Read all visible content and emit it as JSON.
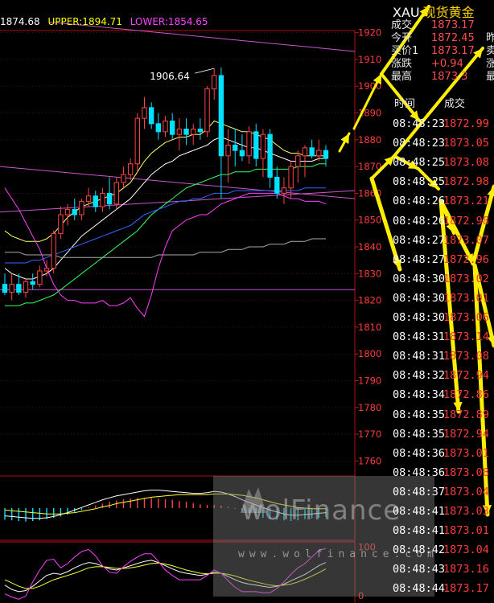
{
  "header": {
    "last_value": "1874.68",
    "upper_label": "UPPER:1894.71",
    "lower_label": "LOWER:1854.65",
    "colors": {
      "last": "#ffffff",
      "upper": "#ffff00",
      "lower": "#ff40ff"
    }
  },
  "quote": {
    "symbol": "XAU",
    "name": "现货黄金",
    "rows": [
      {
        "label": "成交",
        "value": "1873.17",
        "right": ""
      },
      {
        "label": "今开",
        "value": "1872.45",
        "right": "昨"
      },
      {
        "label": "买价1",
        "value": "1873.17",
        "right": "卖"
      },
      {
        "label": "涨跌",
        "value": "+0.94",
        "right": "涨"
      },
      {
        "label": "最高",
        "value": "1873.3",
        "right": "最"
      }
    ],
    "tick_headers": {
      "time": "时间",
      "deal": "成交"
    },
    "ticks": [
      {
        "time": "08:48:23",
        "price": "1872.99"
      },
      {
        "time": "08:48:23",
        "price": "1873.05"
      },
      {
        "time": "08:48:25",
        "price": "1873.08"
      },
      {
        "time": "08:48:25",
        "price": "1872.98"
      },
      {
        "time": "08:48:26",
        "price": "1873.21"
      },
      {
        "time": "08:48:26",
        "price": "1872.98"
      },
      {
        "time": "08:48:27",
        "price": "1873.07"
      },
      {
        "time": "08:48:27",
        "price": "1872.96"
      },
      {
        "time": "08:48:30",
        "price": "1873.02"
      },
      {
        "time": "08:48:30",
        "price": "1873.01"
      },
      {
        "time": "08:48:30",
        "price": "1873.06"
      },
      {
        "time": "08:48:31",
        "price": "1873.14"
      },
      {
        "time": "08:48:31",
        "price": "1873.08"
      },
      {
        "time": "08:48:32",
        "price": "1872.94"
      },
      {
        "time": "08:48:34",
        "price": "1872.86"
      },
      {
        "time": "08:48:35",
        "price": "1872.89"
      },
      {
        "time": "08:48:35",
        "price": "1872.94"
      },
      {
        "time": "08:48:36",
        "price": "1873.01"
      },
      {
        "time": "08:48:36",
        "price": "1873.08"
      },
      {
        "time": "08:48:37",
        "price": "1873.04"
      },
      {
        "time": "08:48:41",
        "price": "1873.03"
      },
      {
        "time": "08:48:41",
        "price": "1873.01"
      },
      {
        "time": "08:48:42",
        "price": "1873.04"
      },
      {
        "time": "08:48:43",
        "price": "1873.16"
      },
      {
        "time": "08:48:44",
        "price": "1873.17"
      }
    ]
  },
  "watermark": {
    "brand": "wolFinance",
    "url": "www.wolfinance.com"
  },
  "chart_data": {
    "type": "candlestick",
    "ylim": [
      1755,
      1925
    ],
    "y_ticks": [
      1920,
      1910,
      1900,
      1890,
      1880,
      1870,
      1860,
      1850,
      1840,
      1830,
      1820,
      1810,
      1800,
      1790,
      1780,
      1770,
      1760
    ],
    "y_tick_labels": [
      "1920",
      "1910",
      "1900",
      "1890",
      "1880",
      "1870",
      "1860",
      "1850",
      "1840",
      "1830",
      "1820",
      "1810",
      "1800",
      "1790",
      "1780",
      "1770",
      "1760"
    ],
    "annotation": {
      "text": "1906.64",
      "value": 1906.64
    },
    "candles": [
      [
        1826,
        1830,
        1822,
        1823
      ],
      [
        1823,
        1830,
        1820,
        1826
      ],
      [
        1826,
        1830,
        1822,
        1823
      ],
      [
        1823,
        1828,
        1821,
        1827
      ],
      [
        1827,
        1830,
        1824,
        1826
      ],
      [
        1826,
        1833,
        1825,
        1831
      ],
      [
        1831,
        1835,
        1829,
        1832
      ],
      [
        1832,
        1846,
        1830,
        1845
      ],
      [
        1845,
        1855,
        1843,
        1852
      ],
      [
        1852,
        1856,
        1848,
        1854
      ],
      [
        1854,
        1858,
        1850,
        1852
      ],
      [
        1852,
        1858,
        1850,
        1857
      ],
      [
        1857,
        1862,
        1855,
        1859
      ],
      [
        1859,
        1861,
        1853,
        1855
      ],
      [
        1855,
        1862,
        1853,
        1860
      ],
      [
        1860,
        1866,
        1854,
        1856
      ],
      [
        1856,
        1866,
        1854,
        1864
      ],
      [
        1864,
        1870,
        1862,
        1867
      ],
      [
        1867,
        1873,
        1865,
        1871
      ],
      [
        1871,
        1890,
        1868,
        1888
      ],
      [
        1888,
        1896,
        1884,
        1892
      ],
      [
        1892,
        1894,
        1884,
        1886
      ],
      [
        1886,
        1890,
        1880,
        1883
      ],
      [
        1883,
        1889,
        1881,
        1887
      ],
      [
        1887,
        1890,
        1880,
        1882
      ],
      [
        1882,
        1888,
        1876,
        1884
      ],
      [
        1884,
        1888,
        1878,
        1882
      ],
      [
        1882,
        1886,
        1878,
        1884
      ],
      [
        1884,
        1888,
        1880,
        1883
      ],
      [
        1883,
        1900,
        1881,
        1899
      ],
      [
        1899,
        1906.6,
        1895,
        1904
      ],
      [
        1904,
        1907,
        1858,
        1874
      ],
      [
        1874,
        1884,
        1864,
        1878
      ],
      [
        1878,
        1884,
        1870,
        1876
      ],
      [
        1876,
        1882,
        1872,
        1874
      ],
      [
        1874,
        1885,
        1871,
        1883
      ],
      [
        1883,
        1886,
        1870,
        1873
      ],
      [
        1873,
        1884,
        1866,
        1882
      ],
      [
        1882,
        1884,
        1862,
        1866
      ],
      [
        1866,
        1870,
        1858,
        1860
      ],
      [
        1860,
        1866,
        1856,
        1862
      ],
      [
        1862,
        1872,
        1858,
        1870
      ],
      [
        1870,
        1876,
        1864,
        1874
      ],
      [
        1874,
        1878,
        1866,
        1877
      ],
      [
        1877,
        1880,
        1873,
        1874
      ],
      [
        1874,
        1880,
        1872,
        1876
      ],
      [
        1876,
        1878,
        1870,
        1873
      ]
    ],
    "series": [
      {
        "values": [
          1846,
          1844,
          1843,
          1842,
          1842,
          1842,
          1843,
          1845,
          1848,
          1851,
          1853,
          1855,
          1856,
          1857,
          1858,
          1859,
          1860,
          1862,
          1864,
          1868,
          1872,
          1875,
          1877,
          1879,
          1880,
          1881,
          1881,
          1882,
          1882,
          1884,
          1887,
          1886,
          1885,
          1884,
          1883,
          1883,
          1882,
          1881,
          1880,
          1878,
          1876,
          1875,
          1875,
          1874,
          1874,
          1874,
          1874
        ],
        "color": "#ffff66"
      },
      {
        "values": [
          1832,
          1830,
          1829,
          1828,
          1828,
          1829,
          1830,
          1832,
          1835,
          1838,
          1841,
          1844,
          1846,
          1848,
          1850,
          1852,
          1854,
          1856,
          1858,
          1861,
          1864,
          1867,
          1869,
          1871,
          1872,
          1874,
          1875,
          1876,
          1877,
          1878,
          1880,
          1881,
          1880,
          1879,
          1878,
          1877,
          1877,
          1876,
          1875,
          1874,
          1873,
          1872,
          1872,
          1872,
          1872,
          1873,
          1873
        ],
        "color": "#ffffff"
      },
      {
        "values": [
          1818,
          1818,
          1818,
          1819,
          1819,
          1820,
          1821,
          1822,
          1824,
          1826,
          1828,
          1830,
          1832,
          1834,
          1836,
          1838,
          1840,
          1842,
          1844,
          1846,
          1849,
          1852,
          1854,
          1856,
          1858,
          1860,
          1862,
          1863,
          1864,
          1865,
          1866,
          1867,
          1867,
          1868,
          1868,
          1868,
          1869,
          1869,
          1869,
          1869,
          1869,
          1869,
          1870,
          1870,
          1870,
          1871,
          1871
        ],
        "color": "#33ff66"
      },
      {
        "values": [
          1834,
          1834,
          1834,
          1834,
          1835,
          1835,
          1836,
          1837,
          1838,
          1839,
          1840,
          1841,
          1842,
          1843,
          1844,
          1845,
          1846,
          1847,
          1848,
          1850,
          1852,
          1853,
          1854,
          1855,
          1856,
          1857,
          1857,
          1858,
          1858,
          1859,
          1860,
          1860,
          1860,
          1861,
          1861,
          1861,
          1861,
          1861,
          1861,
          1861,
          1861,
          1861,
          1861,
          1862,
          1862,
          1862,
          1862
        ],
        "color": "#3366ff"
      },
      {
        "values": [
          1838,
          1838,
          1838,
          1837,
          1837,
          1837,
          1837,
          1837,
          1836,
          1836,
          1836,
          1836,
          1836,
          1836,
          1836,
          1836,
          1836,
          1836,
          1836,
          1836,
          1836,
          1836,
          1837,
          1837,
          1837,
          1837,
          1837,
          1837,
          1838,
          1838,
          1838,
          1838,
          1839,
          1839,
          1839,
          1840,
          1840,
          1840,
          1841,
          1841,
          1841,
          1842,
          1842,
          1842,
          1843,
          1843,
          1843
        ],
        "color": "#aaaaaa"
      },
      {
        "values": [
          1862,
          1858,
          1854,
          1849,
          1844,
          1839,
          1832,
          1826,
          1822,
          1820,
          1820,
          1819,
          1819,
          1819,
          1820,
          1818,
          1818,
          1819,
          1821,
          1817,
          1814,
          1822,
          1832,
          1840,
          1846,
          1848,
          1850,
          1851,
          1852,
          1852,
          1854,
          1856,
          1857,
          1858,
          1859,
          1860,
          1860,
          1860,
          1860,
          1860,
          1859,
          1858,
          1858,
          1857,
          1857,
          1857,
          1856
        ],
        "color": "#ff40ff"
      }
    ],
    "lines": [
      {
        "from": [
          0,
          1870
        ],
        "to": [
          46,
          1858
        ],
        "color": "#cc55cc"
      },
      {
        "from": [
          0,
          1853
        ],
        "to": [
          46,
          1861
        ],
        "color": "#cc55cc"
      },
      {
        "from": [
          0,
          1824
        ],
        "to": [
          46,
          1824
        ],
        "color": "#cc55cc"
      },
      {
        "from": [
          7,
          1924
        ],
        "to": [
          46,
          1913
        ],
        "color": "#cc55cc"
      }
    ],
    "macd": {
      "zero": 0,
      "ylim": [
        -5,
        5
      ],
      "hist": [
        -1.8,
        -1.9,
        -2.0,
        -2.1,
        -2.0,
        -1.9,
        -1.7,
        -1.5,
        -1.3,
        -1.0,
        -0.6,
        -0.3,
        0.1,
        0.4,
        0.7,
        1.0,
        1.2,
        1.4,
        1.5,
        1.6,
        1.6,
        1.6,
        1.5,
        1.4,
        1.3,
        1.1,
        1.0,
        0.8,
        0.6,
        0.5,
        0.5,
        0.4,
        0.2,
        -0.1,
        -0.5,
        -0.9,
        -1.2,
        -1.5,
        -1.7,
        -1.8,
        -1.9,
        -2.0,
        -1.9,
        -1.7,
        -1.6,
        -1.5,
        -1.4
      ],
      "dif": [
        -1.2,
        -1.3,
        -1.4,
        -1.5,
        -1.6,
        -1.6,
        -1.5,
        -1.3,
        -1.0,
        -0.7,
        -0.3,
        0.1,
        0.5,
        0.9,
        1.3,
        1.6,
        1.9,
        2.1,
        2.3,
        2.5,
        2.7,
        2.8,
        2.8,
        2.7,
        2.6,
        2.5,
        2.4,
        2.3,
        2.3,
        2.4,
        2.6,
        2.5,
        2.2,
        1.8,
        1.3,
        0.9,
        0.5,
        0.1,
        -0.3,
        -0.6,
        -0.9,
        -1.1,
        -1.1,
        -1.0,
        -0.9,
        -0.8,
        -0.7
      ],
      "dea": [
        -0.3,
        -0.4,
        -0.5,
        -0.6,
        -0.7,
        -0.8,
        -0.9,
        -0.9,
        -0.9,
        -0.8,
        -0.7,
        -0.5,
        -0.3,
        -0.1,
        0.2,
        0.4,
        0.7,
        0.9,
        1.1,
        1.3,
        1.5,
        1.7,
        1.8,
        1.9,
        2.0,
        2.1,
        2.1,
        2.1,
        2.1,
        2.1,
        2.2,
        2.2,
        2.2,
        2.1,
        2.0,
        1.8,
        1.6,
        1.3,
        1.0,
        0.7,
        0.5,
        0.3,
        0.1,
        0.0,
        -0.1,
        -0.1,
        -0.1
      ],
      "colors": {
        "pos": "#ff4444",
        "neg": "#00ddff",
        "dif": "#ffffff",
        "dea": "#ffff33"
      }
    },
    "kdj": {
      "ylim": [
        0,
        110
      ],
      "y_tick_labels": [
        "100",
        "0"
      ],
      "k": [
        30,
        22,
        18,
        20,
        28,
        38,
        48,
        52,
        50,
        55,
        62,
        68,
        72,
        70,
        65,
        60,
        58,
        62,
        66,
        70,
        74,
        76,
        72,
        66,
        60,
        55,
        52,
        50,
        48,
        50,
        54,
        52,
        46,
        40,
        35,
        32,
        30,
        28,
        26,
        28,
        32,
        38,
        44,
        50,
        58,
        66,
        72
      ],
      "d": [
        40,
        34,
        28,
        24,
        24,
        28,
        34,
        40,
        44,
        48,
        52,
        57,
        62,
        64,
        64,
        63,
        61,
        61,
        62,
        64,
        67,
        70,
        71,
        69,
        66,
        62,
        58,
        55,
        52,
        51,
        52,
        52,
        50,
        47,
        43,
        39,
        36,
        33,
        30,
        29,
        30,
        32,
        36,
        41,
        47,
        53,
        60
      ],
      "j": [
        14,
        8,
        4,
        10,
        36,
        58,
        76,
        78,
        62,
        70,
        82,
        92,
        96,
        84,
        66,
        54,
        52,
        64,
        74,
        82,
        88,
        88,
        74,
        58,
        48,
        40,
        40,
        40,
        40,
        48,
        58,
        52,
        38,
        26,
        18,
        18,
        18,
        16,
        16,
        24,
        36,
        50,
        62,
        70,
        82,
        94,
        98
      ],
      "colors": {
        "k": "#ffffff",
        "d": "#ffff33",
        "j": "#ff40ff"
      }
    }
  }
}
